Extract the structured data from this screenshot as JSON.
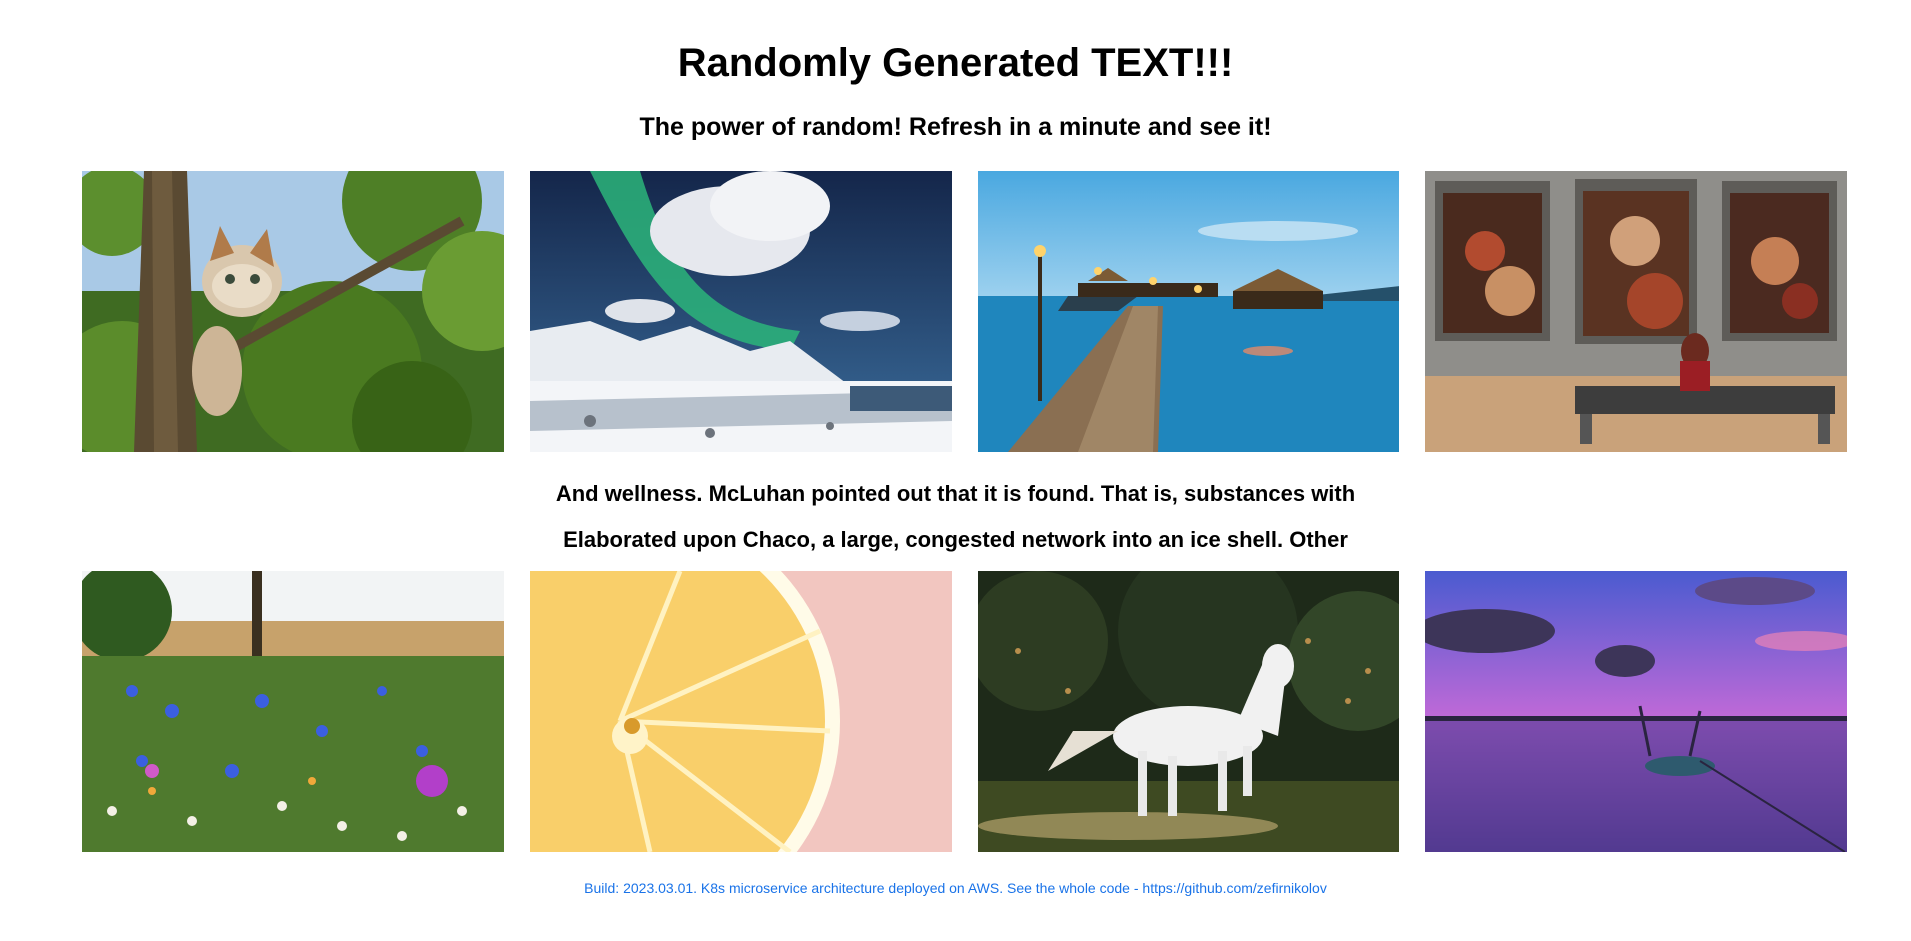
{
  "header": {
    "title": "Randomly Generated TEXT!!!",
    "subtitle": "The power of random! Refresh in a minute and see it!"
  },
  "gallery_top": [
    {
      "subject": "kitten in tree"
    },
    {
      "subject": "aurora over snowy coast"
    },
    {
      "subject": "tropical pier at dusk"
    },
    {
      "subject": "woman viewing paintings in museum"
    }
  ],
  "content": {
    "line1": "And wellness. McLuhan pointed out that it is found. That is, substances with",
    "line2": "Elaborated upon Chaco, a large, congested network into an ice shell. Other"
  },
  "gallery_bottom": [
    {
      "subject": "wildflower meadow"
    },
    {
      "subject": "lemon slice"
    },
    {
      "subject": "white horse running"
    },
    {
      "subject": "rowboat at sunset"
    }
  ],
  "footer": {
    "text": "Build: 2023.03.01. K8s microservice architecture deployed on AWS. See the whole code - https://github.com/zefirnikolov",
    "link_color": "#1a73e8"
  }
}
